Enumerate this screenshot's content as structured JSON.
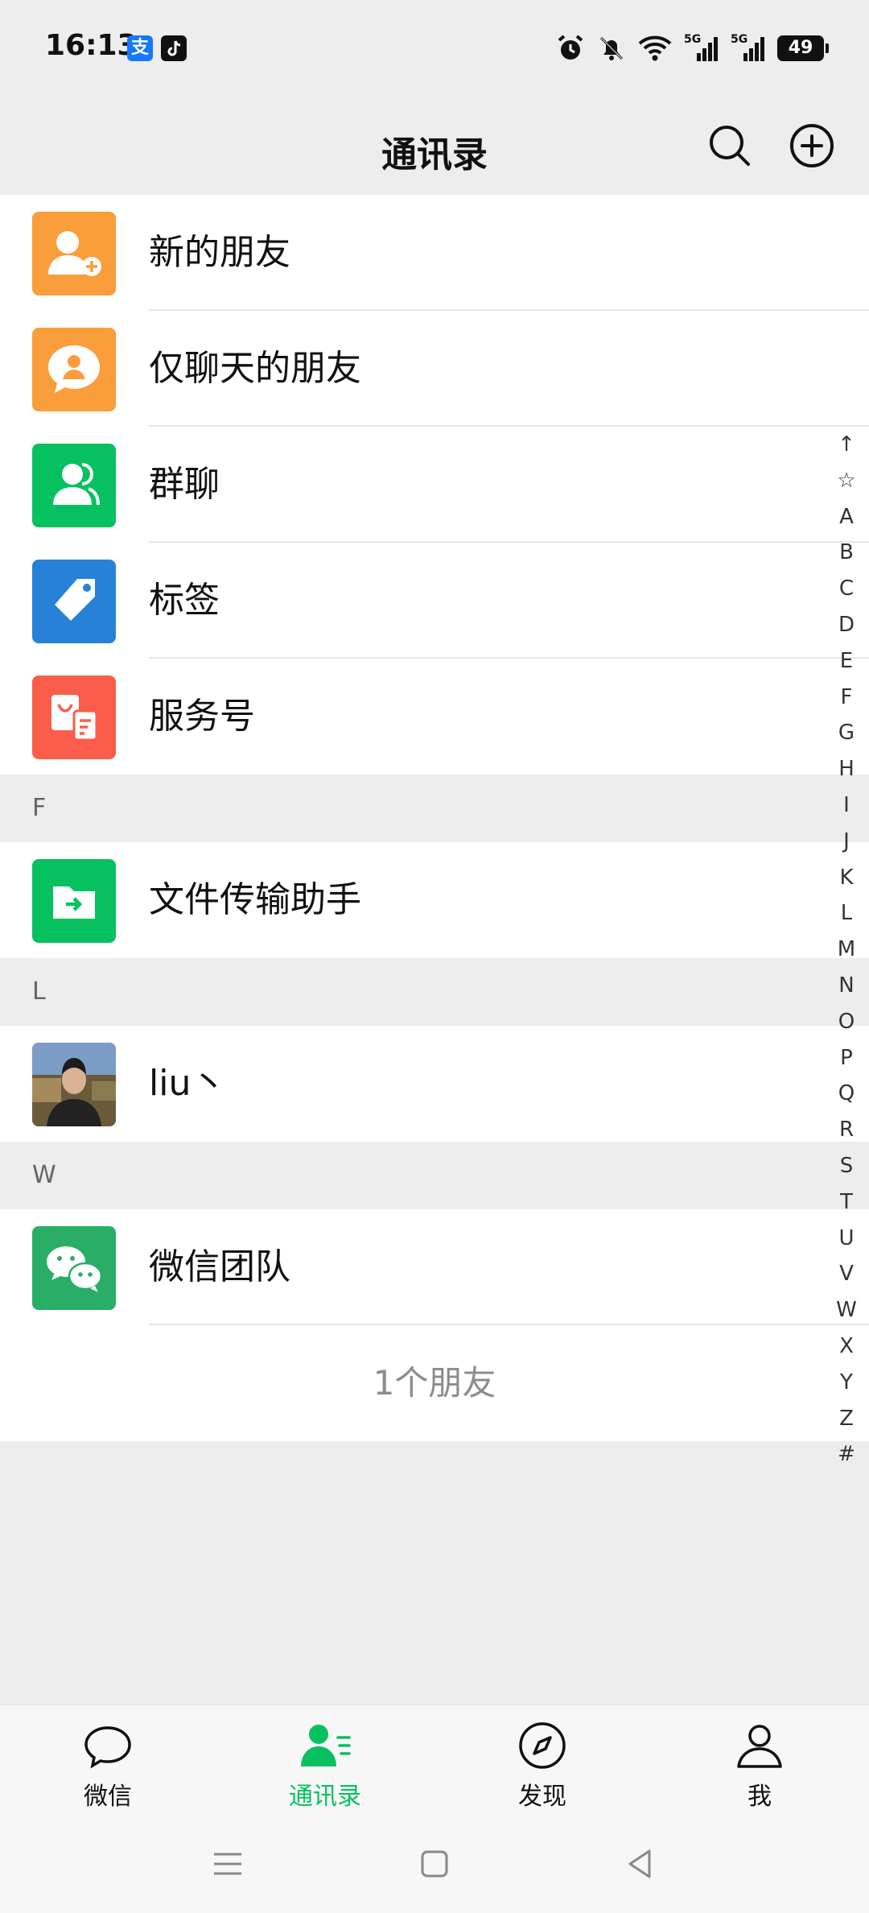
{
  "status_bar": {
    "time": "16:13",
    "alipay_badge": "支",
    "battery": "49",
    "net1": "5G",
    "net2": "5G"
  },
  "header": {
    "title": "通讯录",
    "icons": [
      "search-icon",
      "add-circle-icon"
    ]
  },
  "menu_items": [
    {
      "label": "新的朋友",
      "icon": "new-friend-icon",
      "color": "#fa9d3b"
    },
    {
      "label": "仅聊天的朋友",
      "icon": "chat-only-friend-icon",
      "color": "#fa9d3b"
    },
    {
      "label": "群聊",
      "icon": "group-chat-icon",
      "color": "#07c160"
    },
    {
      "label": "标签",
      "icon": "tag-icon",
      "color": "#2782d7"
    },
    {
      "label": "服务号",
      "icon": "service-account-icon",
      "color": "#fa5e4a"
    }
  ],
  "sections": [
    {
      "letter": "F",
      "contacts": [
        {
          "name": "文件传输助手",
          "icon": "file-transfer-icon",
          "color": "#07c160"
        }
      ]
    },
    {
      "letter": "L",
      "contacts": [
        {
          "name": "liu丶",
          "icon": "avatar-photo"
        }
      ]
    },
    {
      "letter": "W",
      "contacts": [
        {
          "name": "微信团队",
          "icon": "wechat-team-icon",
          "color": "#2aae67"
        }
      ]
    }
  ],
  "friend_count": "1个朋友",
  "index_letters": [
    "↑",
    "☆",
    "A",
    "B",
    "C",
    "D",
    "E",
    "F",
    "G",
    "H",
    "I",
    "J",
    "K",
    "L",
    "M",
    "N",
    "O",
    "P",
    "Q",
    "R",
    "S",
    "T",
    "U",
    "V",
    "W",
    "X",
    "Y",
    "Z",
    "#"
  ],
  "bottom_nav": {
    "tabs": [
      {
        "label": "微信",
        "icon": "chat-bubble-icon",
        "active": false
      },
      {
        "label": "通讯录",
        "icon": "contacts-icon",
        "active": true
      },
      {
        "label": "发现",
        "icon": "compass-icon",
        "active": false
      },
      {
        "label": "我",
        "icon": "person-icon",
        "active": false
      }
    ],
    "accent_color": "#07c160"
  },
  "system_nav": [
    "menu-icon",
    "home-icon",
    "back-icon"
  ]
}
